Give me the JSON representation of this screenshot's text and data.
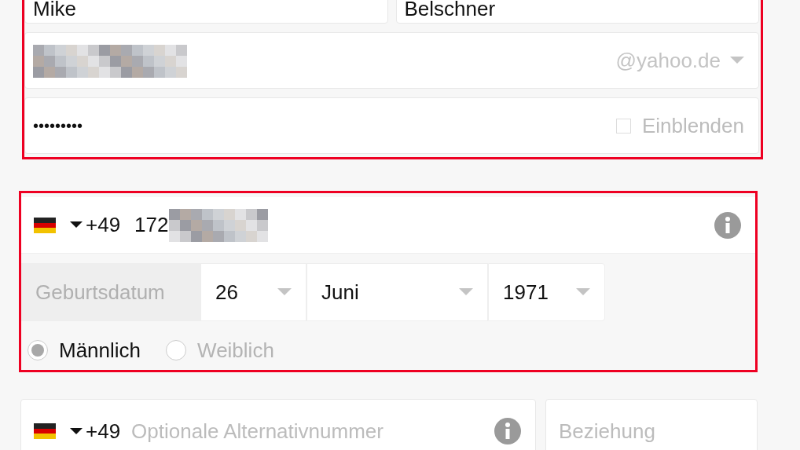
{
  "name_fields": [
    {
      "value": "Mike"
    },
    {
      "value": "Belschner"
    }
  ],
  "email": {
    "domain": "@yahoo.de"
  },
  "password": {
    "value": "•••••••••",
    "show_label": "Einblenden",
    "show_checked": false
  },
  "phone": {
    "country_code": "+49",
    "number": "172"
  },
  "birthdate": {
    "label": "Geburtsdatum",
    "day": "26",
    "month": "Juni",
    "year": "1971"
  },
  "gender": [
    {
      "label": "Männlich",
      "selected": true
    },
    {
      "label": "Weiblich",
      "selected": false
    }
  ],
  "alt_phone": {
    "country_code": "+49",
    "placeholder": "Optionale Alternativnummer"
  },
  "relationship": {
    "placeholder": "Beziehung"
  }
}
